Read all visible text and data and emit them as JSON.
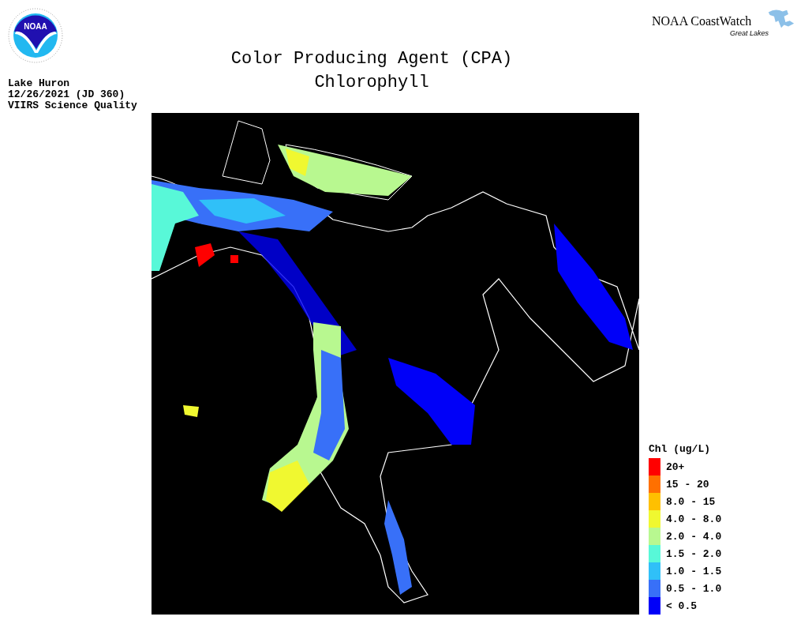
{
  "header": {
    "title": "Color Producing Agent (CPA)",
    "subtitle": "Chlorophyll",
    "info": [
      "Lake Huron",
      "12/26/2021 (JD 360)",
      "VIIRS Science Quality"
    ],
    "logo_text": "NOAA",
    "brand": "NOAA CoastWatch",
    "brand_sub": "Great Lakes"
  },
  "legend": {
    "title": "Chl (ug/L)",
    "items": [
      {
        "label": "20+",
        "color": "#ff0000"
      },
      {
        "label": "15 - 20",
        "color": "#ff7000"
      },
      {
        "label": "8.0 - 15",
        "color": "#ffc000"
      },
      {
        "label": "4.0 - 8.0",
        "color": "#f0f830"
      },
      {
        "label": "2.0 - 4.0",
        "color": "#b8f890"
      },
      {
        "label": "1.5 - 2.0",
        "color": "#58f8d8"
      },
      {
        "label": "1.0 - 1.5",
        "color": "#30c0f8"
      },
      {
        "label": "0.5 - 1.0",
        "color": "#3870f8"
      },
      {
        "label": "< 0.5",
        "color": "#0000f8"
      }
    ]
  }
}
